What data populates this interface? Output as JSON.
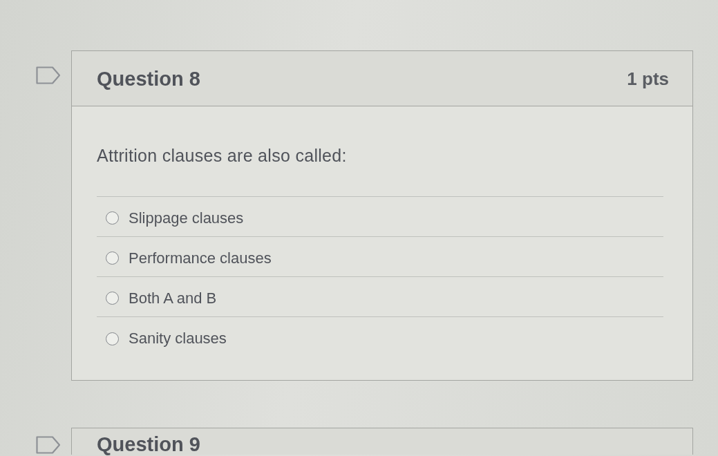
{
  "questions": [
    {
      "title": "Question 8",
      "points": "1 pts",
      "flagged": false,
      "text": "Attrition clauses are also called:",
      "answers": [
        {
          "label": "Slippage clauses",
          "selected": false
        },
        {
          "label": "Performance clauses",
          "selected": false
        },
        {
          "label": "Both A and B",
          "selected": false
        },
        {
          "label": "Sanity clauses",
          "selected": false
        }
      ]
    },
    {
      "title": "Question 9",
      "flagged": false
    }
  ]
}
